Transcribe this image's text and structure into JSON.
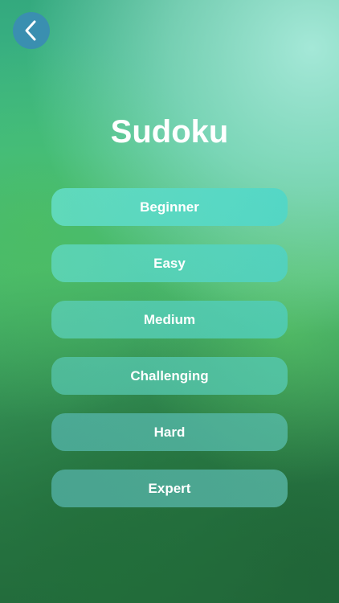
{
  "header": {
    "back_icon": "chevron-left-icon",
    "title": "Sudoku"
  },
  "menu": {
    "levels": [
      {
        "label": "Beginner"
      },
      {
        "label": "Easy"
      },
      {
        "label": "Medium"
      },
      {
        "label": "Challenging"
      },
      {
        "label": "Hard"
      },
      {
        "label": "Expert"
      }
    ]
  },
  "colors": {
    "back_button": "#3a8fb0",
    "text": "#ffffff",
    "button_fill": "#55d2c0"
  }
}
